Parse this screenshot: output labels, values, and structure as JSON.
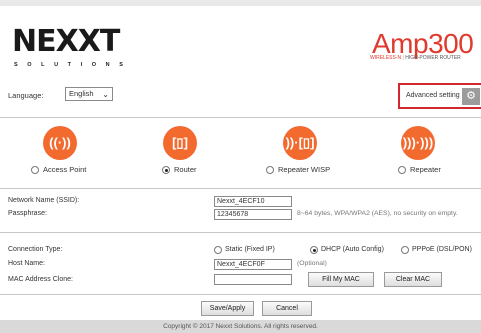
{
  "header": {
    "logo_text": "NEXXT",
    "logo_sub": "SOLUTIONS",
    "product_name": "Amp300",
    "product_sub_red": "WIRELESS-N",
    "product_sub_sep": "|",
    "product_sub_grey": "HIGH-POWER ROUTER"
  },
  "language": {
    "label": "Language:",
    "selected": "English"
  },
  "advanced": {
    "label": "Advanced setting",
    "icon": "gear-icon"
  },
  "modes": [
    {
      "label": "Access Point",
      "icon": "access-point-icon",
      "glyph": "((·))",
      "selected": false
    },
    {
      "label": "Router",
      "icon": "router-icon",
      "glyph": "[▯]",
      "selected": true
    },
    {
      "label": "Repeater WISP",
      "icon": "repeater-wisp-icon",
      "glyph": "))·[▯]",
      "selected": false
    },
    {
      "label": "Repeater",
      "icon": "repeater-icon",
      "glyph": ")))·)))",
      "selected": false
    }
  ],
  "wireless": {
    "ssid_label": "Network Name (SSID):",
    "ssid_value": "Nexxt_4ECF10",
    "pass_label": "Passphrase:",
    "pass_value": "12345678",
    "pass_hint": "8~64 bytes, WPA/WPA2 (AES), no security on empty."
  },
  "connection": {
    "label": "Connection Type:",
    "options": [
      {
        "label": "Static (Fixed IP)",
        "selected": false
      },
      {
        "label": "DHCP (Auto Config)",
        "selected": true
      },
      {
        "label": "PPPoE (DSL/PON)",
        "selected": false
      }
    ],
    "host_label": "Host Name:",
    "host_value": "Nexxt_4ECF0F",
    "host_hint": "(Optional)",
    "mac_label": "MAC Address Clone:",
    "mac_value": "",
    "fill_mac": "Fill My MAC",
    "clear_mac": "Clear MAC"
  },
  "actions": {
    "save": "Save/Apply",
    "cancel": "Cancel"
  },
  "footer": {
    "copyright": "Copyright © 2017 Nexxt Solutions. All rights reserved."
  },
  "colors": {
    "accent": "#f26a2e",
    "brand_red": "#e03a2e",
    "highlight_border": "#d22630"
  }
}
